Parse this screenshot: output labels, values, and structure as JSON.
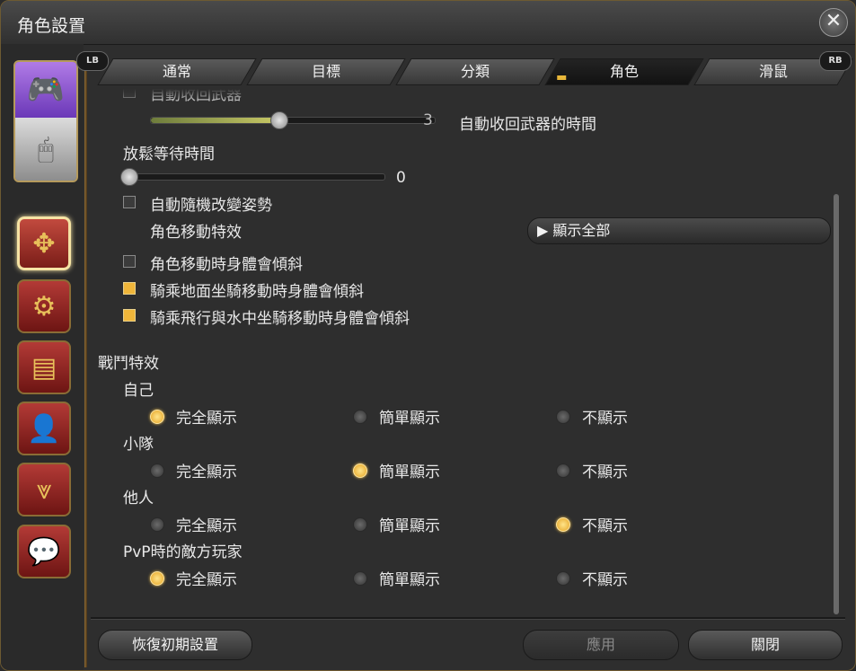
{
  "window": {
    "title": "角色設置"
  },
  "tabs": [
    {
      "label": "通常"
    },
    {
      "label": "目標"
    },
    {
      "label": "分類"
    },
    {
      "label": "角色"
    },
    {
      "label": "滑鼠"
    }
  ],
  "tab_hints": {
    "left": "LB",
    "right": "RB"
  },
  "sidebar_icons": [
    "gamepad-icon",
    "mouse-icon",
    "arrows-icon",
    "gear-bag-icon",
    "card-icon",
    "profile-icon",
    "chevron-pattern-icon",
    "chat-icon"
  ],
  "settings": {
    "partial_label": "自動收回武器",
    "sheathe_slider": {
      "value": "3",
      "fill": 0.45,
      "label": "自動收回武器的時間"
    },
    "idle_wait": {
      "label": "放鬆等待時間",
      "value": "0",
      "fill": 0.0
    },
    "auto_pose": {
      "label": "自動隨機改變姿勢",
      "checked": false
    },
    "move_effect": {
      "label": "角色移動特效",
      "button": "▶ 顯示全部"
    },
    "body_tilt": {
      "label": "角色移動時身體會傾斜",
      "checked": false
    },
    "mount_ground_tilt": {
      "label": "騎乘地面坐騎移動時身體會傾斜",
      "checked": true
    },
    "mount_fly_tilt": {
      "label": "騎乘飛行與水中坐騎移動時身體會傾斜",
      "checked": true
    }
  },
  "battle_effects": {
    "heading": "戰鬥特效",
    "options": [
      "完全顯示",
      "簡單顯示",
      "不顯示"
    ],
    "groups": [
      {
        "label": "自己",
        "selected": 0
      },
      {
        "label": "小隊",
        "selected": 1
      },
      {
        "label": "他人",
        "selected": 2
      },
      {
        "label": "PvP時的敵方玩家",
        "selected": 0
      }
    ]
  },
  "footer": {
    "reset": "恢復初期設置",
    "apply": "應用",
    "close": "關閉"
  }
}
